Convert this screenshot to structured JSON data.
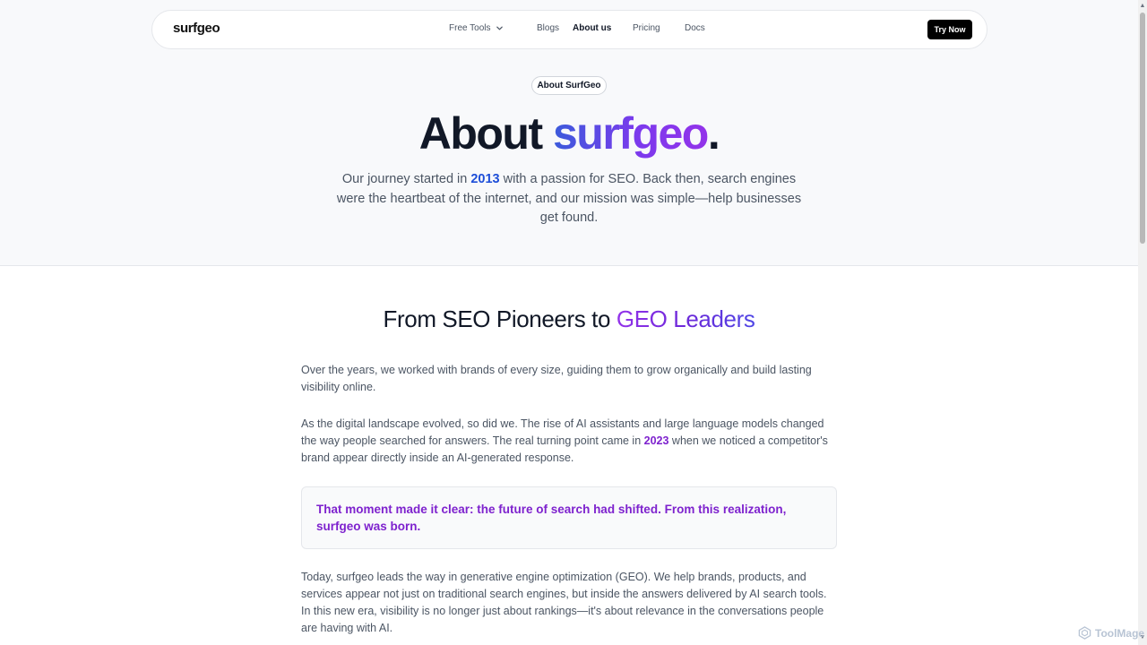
{
  "nav": {
    "logo": "surfgeo",
    "links": [
      {
        "label": "Free Tools"
      },
      {
        "label": "Blogs"
      },
      {
        "label": "About us"
      },
      {
        "label": "Pricing"
      },
      {
        "label": "Docs"
      }
    ],
    "cta_label": "Try Now"
  },
  "hero": {
    "badge": "About SurfGeo",
    "title_prefix": "About ",
    "title_brand": "surfgeo",
    "title_suffix": ".",
    "desc_part1": "Our journey started in ",
    "desc_year": "2013",
    "desc_part2": " with a passion for SEO. Back then, search engines were the heartbeat of the internet, and our mission was simple—help businesses get found."
  },
  "story": {
    "title_prefix": "From SEO Pioneers to ",
    "title_highlight": "GEO Leaders",
    "p1": "Over the years, we worked with brands of every size, guiding them to grow organically and build lasting visibility online.",
    "p2_part1": "As the digital landscape evolved, so did we. The rise of AI assistants and large language models changed the way people searched for answers. The real turning point came in ",
    "p2_year": "2023",
    "p2_part2": " when we noticed a competitor's brand appear directly inside an AI-generated response.",
    "quote": "That moment made it clear: the future of search had shifted. From this realization, surfgeo was born.",
    "p4": "Today, surfgeo leads the way in generative engine optimization (GEO). We help brands, products, and services appear not just on traditional search engines, but inside the answers delivered by AI search tools. In this new era, visibility is no longer just about rankings—it's about relevance in the conversations people are having with AI."
  },
  "watermark": "ToolMage",
  "colors": {
    "accent_blue": "#1d4ed8",
    "accent_purple": "#7e22ce",
    "cta_bg": "#000000"
  }
}
